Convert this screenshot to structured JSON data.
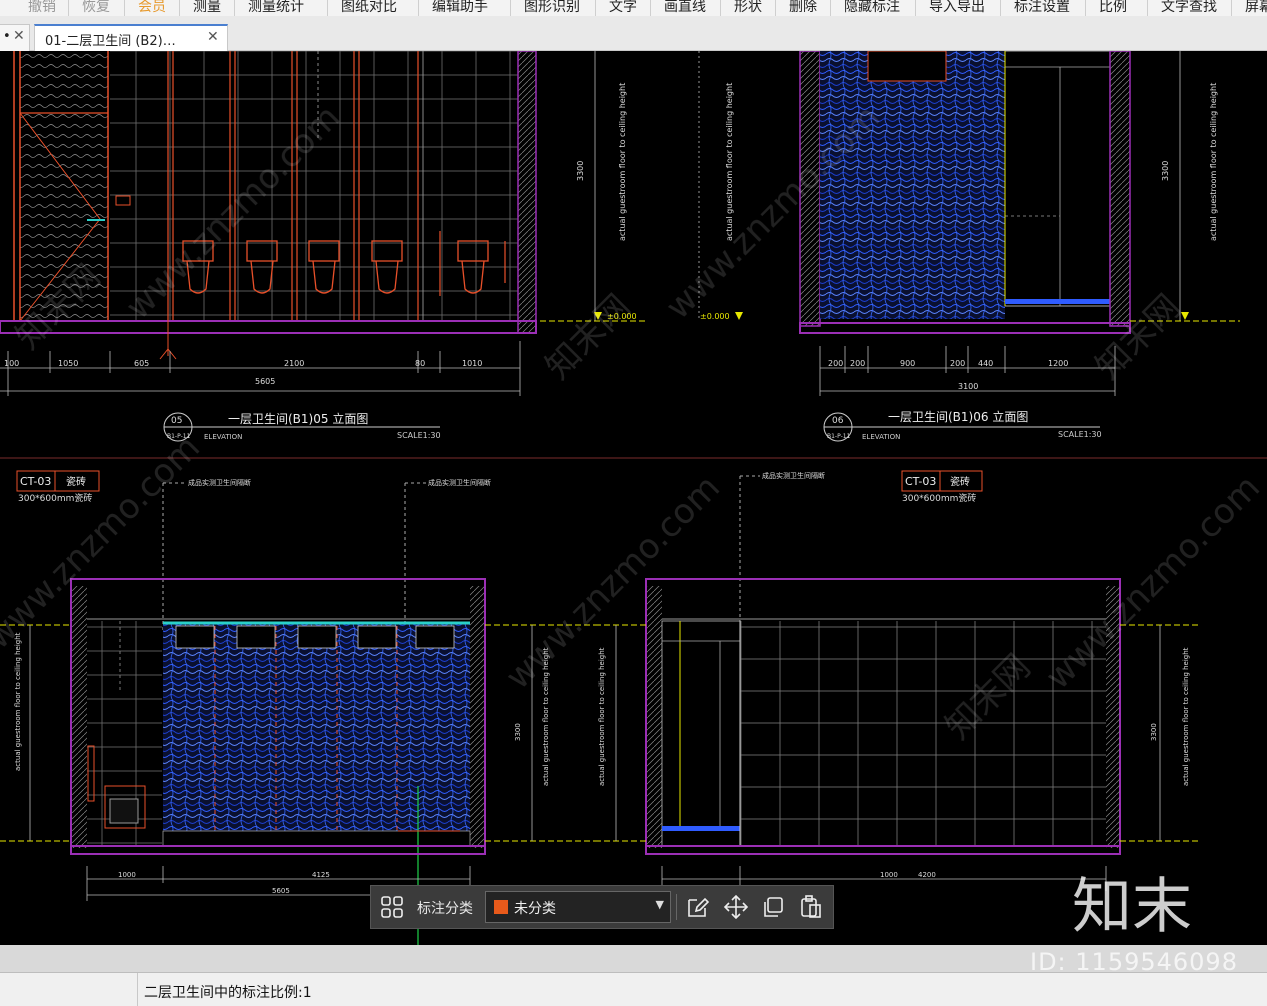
{
  "menu": {
    "items": [
      {
        "label": "撤销",
        "state": "disabled"
      },
      {
        "label": "恢复",
        "state": "disabled"
      },
      {
        "label": "会员",
        "state": "vip"
      },
      {
        "label": "测量",
        "state": "normal"
      },
      {
        "label": "测量统计",
        "state": "normal"
      },
      {
        "label": "图纸对比",
        "state": "normal"
      },
      {
        "label": "编辑助手",
        "state": "normal"
      },
      {
        "label": "图形识别",
        "state": "normal"
      },
      {
        "label": "文字",
        "state": "normal"
      },
      {
        "label": "画直线",
        "state": "normal"
      },
      {
        "label": "形状",
        "state": "normal"
      },
      {
        "label": "删除",
        "state": "normal"
      },
      {
        "label": "隐藏标注",
        "state": "normal"
      },
      {
        "label": "导入导出",
        "state": "normal"
      },
      {
        "label": "标注设置",
        "state": "normal"
      },
      {
        "label": "比例",
        "state": "normal"
      },
      {
        "label": "文字查找",
        "state": "normal"
      },
      {
        "label": "屏幕",
        "state": "normal"
      }
    ]
  },
  "tabs": [
    {
      "label": "•",
      "close": "✕",
      "active": false
    },
    {
      "label": "01-二层卫生间 (B2)…",
      "close": "✕",
      "active": true
    }
  ],
  "drawing": {
    "top_left": {
      "number": "05",
      "sheet": "B1-P-11",
      "title": "一层卫生间(B1)05 立面图",
      "subtitle": "ELEVATION",
      "scale": "SCALE1:30",
      "dims": [
        "100",
        "1050",
        "605",
        "2100",
        "80",
        "1010"
      ],
      "total": "5605",
      "height": "3300",
      "level": "±0.000",
      "note": "actual guestroom floor to ceiling height"
    },
    "top_right": {
      "number": "06",
      "sheet": "B1-P-11",
      "title": "一层卫生间(B1)06 立面图",
      "subtitle": "ELEVATION",
      "scale": "SCALE1:30",
      "dims": [
        "200",
        "200",
        "900",
        "200",
        "440",
        "1200"
      ],
      "total": "3100",
      "height": "3300",
      "level": "±0.000",
      "note": "actual guestroom floor to ceiling height"
    },
    "bottom_left": {
      "material_code": "CT-03",
      "material_name": "瓷砖",
      "material_spec": "300*600mm瓷砖",
      "leader1": "成品实测卫生间隔断",
      "leader2": "成品实测卫生间隔断",
      "dims": [
        "1000",
        "4125"
      ],
      "total": "5605",
      "height": "3300",
      "note": "actual guestroom floor to ceiling height"
    },
    "bottom_right": {
      "material_code": "CT-03",
      "material_name": "瓷砖",
      "material_spec": "300*600mm瓷砖",
      "leader1": "成品实测卫生间隔断",
      "dims": [
        "1000",
        "4200"
      ],
      "height": "3300",
      "note": "actual guestroom floor to ceiling height"
    }
  },
  "watermark": {
    "site": "www.znzmo.com",
    "cn": "知末网",
    "logo": "知末",
    "id": "ID: 1159546098"
  },
  "toolbar": {
    "grid_icon": "grid-icon",
    "label": "标注分类",
    "selected": "未分类",
    "swatch_color": "#e85a1b",
    "arrow": "▼",
    "icons": [
      "edit-icon",
      "move-icon",
      "copy-icon",
      "paste-icon"
    ]
  },
  "status": {
    "text": "二层卫生间中的标注比例:1"
  },
  "colors": {
    "frame": "#9b2fb5",
    "orange": "#e8502a",
    "tile": "#8a8a8a",
    "yellow": "#e8e800",
    "blue_pattern": "#1f4bd8"
  }
}
